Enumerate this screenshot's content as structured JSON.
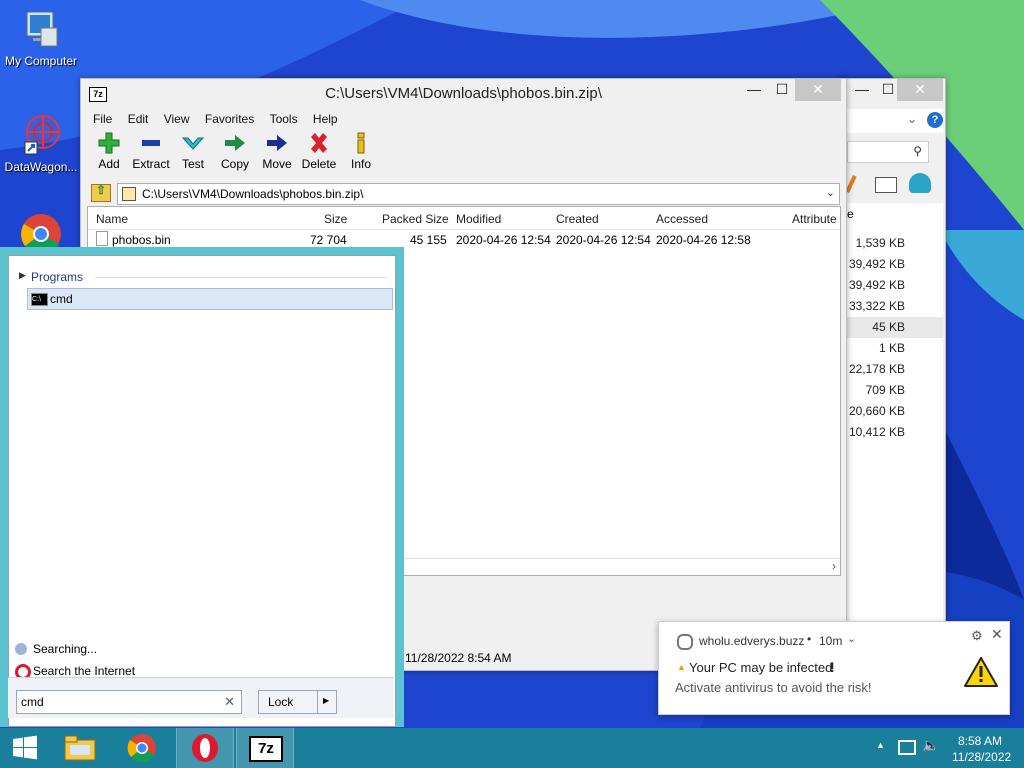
{
  "desktop": {
    "icons": [
      {
        "label": "My Computer"
      },
      {
        "label": "DataWagon..."
      }
    ]
  },
  "zip_window": {
    "title": "C:\\Users\\VM4\\Downloads\\phobos.bin.zip\\",
    "menu": [
      "File",
      "Edit",
      "View",
      "Favorites",
      "Tools",
      "Help"
    ],
    "toolbar": [
      "Add",
      "Extract",
      "Test",
      "Copy",
      "Move",
      "Delete",
      "Info"
    ],
    "address": "C:\\Users\\VM4\\Downloads\\phobos.bin.zip\\",
    "columns": [
      "Name",
      "Size",
      "Packed Size",
      "Modified",
      "Created",
      "Accessed",
      "Attribute"
    ],
    "rows": [
      {
        "name": "phobos.bin",
        "size": "72 704",
        "packed": "45 155",
        "modified": "2020-04-26 12:54",
        "created": "2020-04-26 12:54",
        "accessed": "2020-04-26 12:58"
      }
    ],
    "status_time": "11/28/2022 8:54 AM"
  },
  "bg_window": {
    "column_header": "e",
    "sizes": [
      "1,539 KB",
      "39,492 KB",
      "39,492 KB",
      "33,322 KB",
      "45 KB",
      "1 KB",
      "22,178 KB",
      "709 KB",
      "20,660 KB",
      "10,412 KB"
    ]
  },
  "start_panel": {
    "group": "Programs",
    "results": [
      "cmd"
    ],
    "searching": "Searching...",
    "search_internet": "Search the Internet",
    "query": "cmd",
    "power_label": "Lock"
  },
  "toast": {
    "source": "wholu.edverys.buzz",
    "age": "10m",
    "title": "Your PC may be infected",
    "title_mark": "!",
    "body": "Activate antivirus to avoid the risk!"
  },
  "tray": {
    "time": "8:58 AM",
    "date": "11/28/2022"
  }
}
